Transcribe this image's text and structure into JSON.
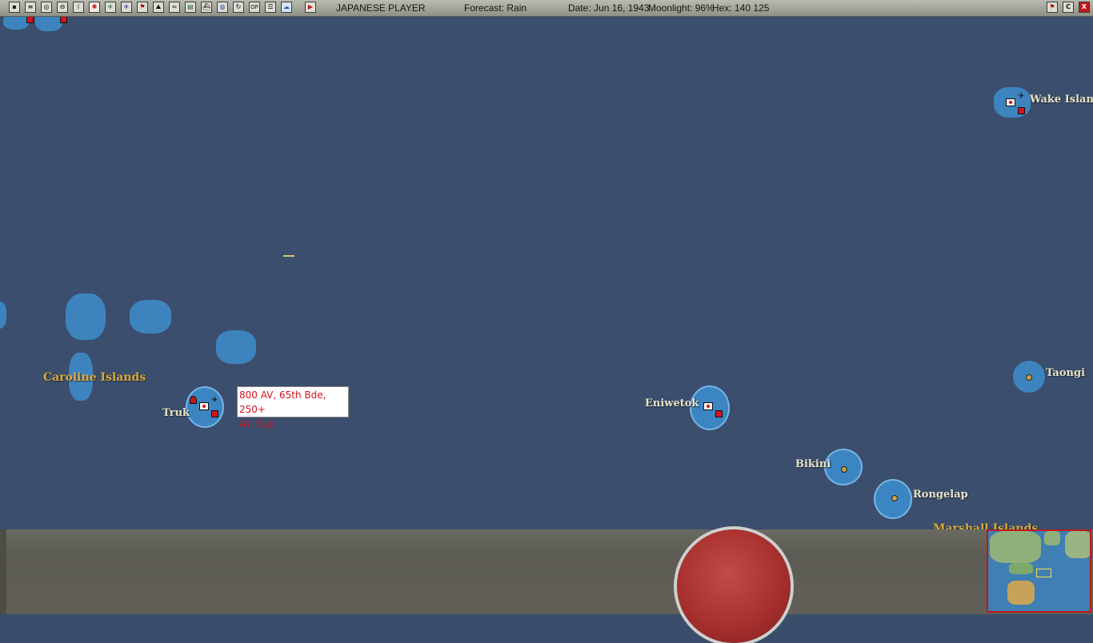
{
  "toolbar": {
    "icons": [
      "map-menu-icon",
      "reports-icon",
      "intel-icon",
      "ships-icon",
      "info-icon",
      "japan-flag-icon",
      "air-units-icon",
      "aircraft-icon",
      "flag-icon",
      "ground-icon",
      "routes-icon",
      "supply-icon",
      "convoy-icon",
      "world-icon",
      "refresh-icon",
      "ops-icon",
      "list-icon",
      "weather-icon",
      "end-turn-icon"
    ],
    "player": "JAPANESE PLAYER",
    "forecast": "Forecast: Rain",
    "date": "Date: Jun 16, 1943",
    "moonlight": "Moonlight: 96%",
    "hex": "Hex: 140 125",
    "right_buttons": [
      "flag-toggle-icon",
      "C",
      "X"
    ]
  },
  "map": {
    "places": {
      "wake": "Wake Island",
      "truk": "Truk",
      "eniwetok": "Eniwetok",
      "taongi": "Taongi",
      "bikini": "Bikini",
      "rongelap": "Rongelap"
    },
    "regions": {
      "caroline": "Caroline Islands",
      "marshall": "Marshall Islands"
    },
    "tooltip": {
      "line1": "800 AV, 65th Bde, 250+",
      "line2": "Av. Sup"
    }
  },
  "colors": {
    "ocean": "#3b4e6d",
    "shoal": "#3d87c4",
    "japan_red": "#d2141b",
    "region_label": "#d9a93a"
  }
}
